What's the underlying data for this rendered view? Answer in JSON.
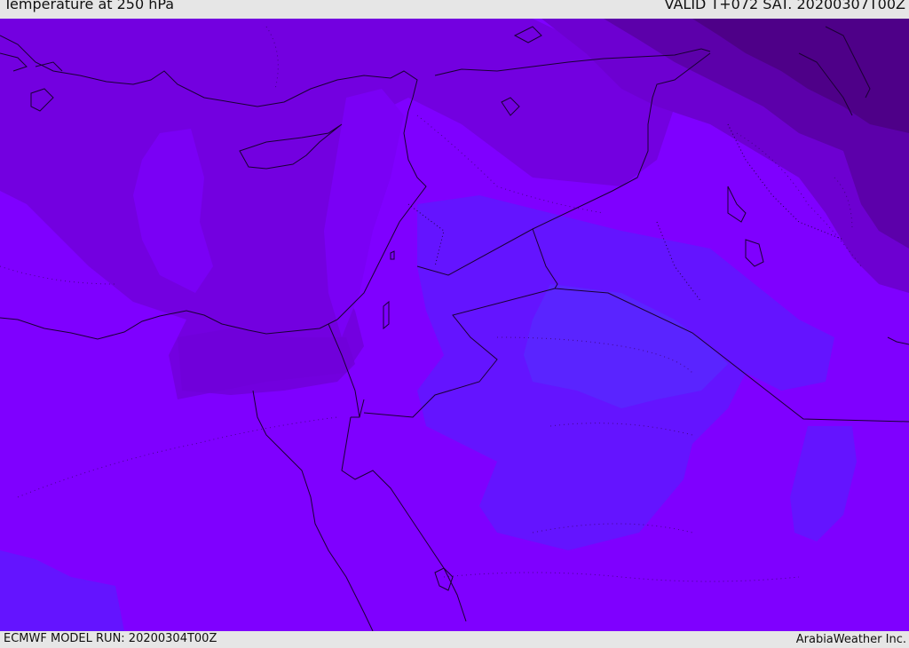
{
  "header": {
    "title": "Temperature at 250 hPa",
    "valid": "VALID T+072 SAT. 20200307T00Z"
  },
  "footer": {
    "model_run": "ECMWF MODEL RUN: 20200304T00Z",
    "credit": "ArabiaWeather Inc."
  },
  "colors": {
    "base_violet": "#7f00ff",
    "mid_purple": "#7300e0",
    "purple": "#6d00d1",
    "dark_purple": "#5c00aa",
    "darkest_purple": "#4e0088",
    "cool_blue": "#6414ff",
    "cooler_blue": "#5a24ff",
    "coastline": "#1a0033"
  }
}
